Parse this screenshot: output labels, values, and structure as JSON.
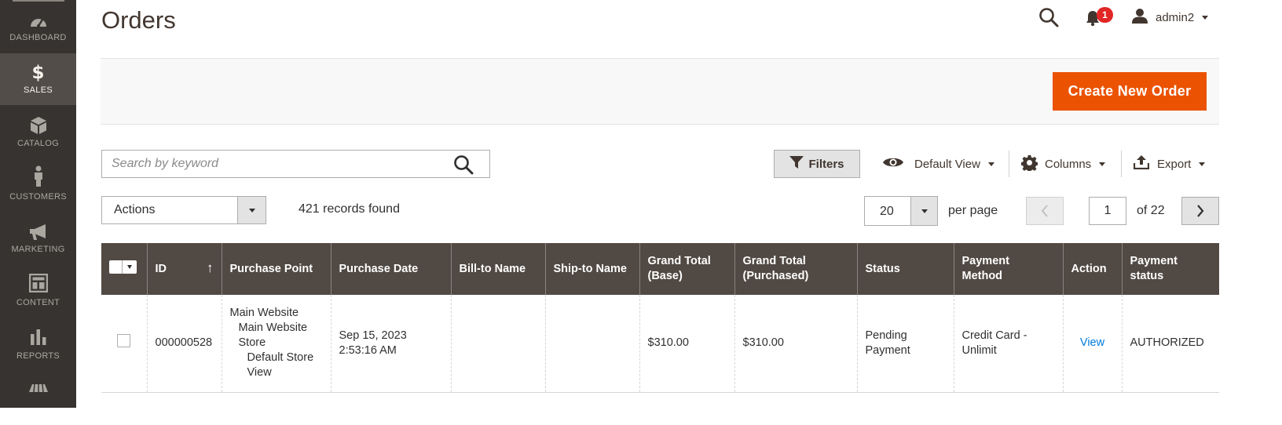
{
  "sidebar": {
    "items": [
      {
        "label": "DASHBOARD",
        "icon": "dashboard-icon"
      },
      {
        "label": "SALES",
        "icon": "dollar-icon",
        "glyph": "$"
      },
      {
        "label": "CATALOG",
        "icon": "box-icon"
      },
      {
        "label": "CUSTOMERS",
        "icon": "person-icon"
      },
      {
        "label": "MARKETING",
        "icon": "megaphone-icon"
      },
      {
        "label": "CONTENT",
        "icon": "layout-icon"
      },
      {
        "label": "REPORTS",
        "icon": "bar-chart-icon"
      }
    ]
  },
  "header": {
    "title": "Orders",
    "notifications_count": "1",
    "username": "admin2"
  },
  "page_actions": {
    "create_label": "Create New Order"
  },
  "toolbar": {
    "search_placeholder": "Search by keyword",
    "filters_label": "Filters",
    "view_label": "Default View",
    "columns_label": "Columns",
    "export_label": "Export",
    "actions_label": "Actions",
    "records_found": "421 records found",
    "per_page_value": "20",
    "per_page_label": "per page",
    "current_page": "1",
    "of_pages": "of 22"
  },
  "grid": {
    "columns": [
      "ID",
      "Purchase Point",
      "Purchase Date",
      "Bill-to Name",
      "Ship-to Name",
      "Grand Total (Base)",
      "Grand Total (Purchased)",
      "Status",
      "Payment Method",
      "Action",
      "Payment status"
    ],
    "header_lines": {
      "grand_total_base": [
        "Grand Total",
        "(Base)"
      ],
      "grand_total_purchased": [
        "Grand Total",
        "(Purchased)"
      ],
      "payment_method": [
        "Payment",
        "Method"
      ],
      "payment_status": [
        "Payment",
        "status"
      ]
    },
    "sort_arrow": "↑",
    "rows": [
      {
        "id": "000000528",
        "purchase_point": [
          "Main Website",
          "Main Website Store",
          "Default Store View"
        ],
        "purchase_date": [
          "Sep 15, 2023",
          "2:53:16 AM"
        ],
        "bill_to_name": "",
        "ship_to_name": "",
        "grand_total_base": "$310.00",
        "grand_total_purchased": "$310.00",
        "status": [
          "Pending",
          "Payment"
        ],
        "payment_method": [
          "Credit Card -",
          "Unlimit"
        ],
        "action": "View",
        "payment_status": "AUTHORIZED"
      }
    ]
  },
  "colors": {
    "sidebar_bg": "#373330",
    "sidebar_active": "#524d49",
    "primary_button": "#eb5202",
    "grid_header": "#514943",
    "badge": "#e22626",
    "link": "#007bdb"
  }
}
